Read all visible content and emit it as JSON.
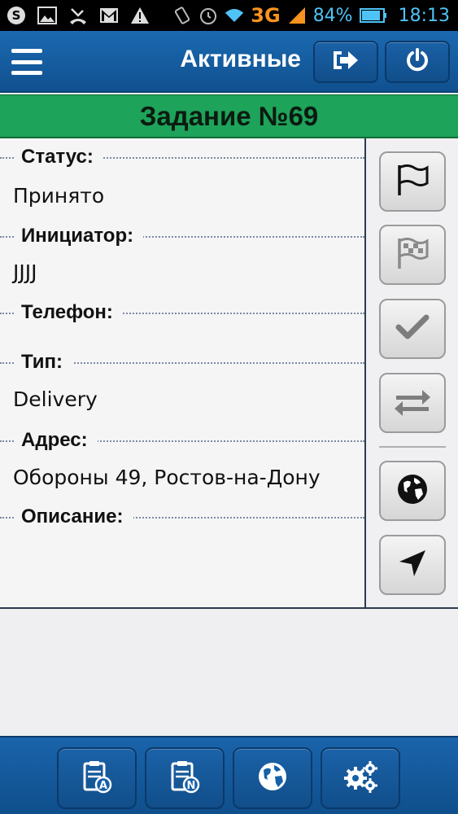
{
  "status_bar": {
    "network": "3G",
    "battery": "84%",
    "time": "18:13",
    "icons": [
      "skype-icon",
      "gallery-icon",
      "missed-call-icon",
      "gmail-icon",
      "warning-icon",
      "vibrate-icon",
      "alarm-icon",
      "wifi-icon",
      "signal-icon",
      "battery-icon"
    ]
  },
  "action_bar": {
    "title": "Активные",
    "menu_icon": "hamburger-menu-icon",
    "logout_icon": "logout-icon",
    "power_icon": "power-icon"
  },
  "task": {
    "title": "Задание №69"
  },
  "details": {
    "status_label": "Статус:",
    "status_value": "Принято",
    "initiator_label": "Инициатор:",
    "initiator_value": "JJJJ",
    "phone_label": "Телефон:",
    "phone_value": "",
    "type_label": "Тип:",
    "type_value": "Delivery",
    "address_label": "Адрес:",
    "address_value": "Обороны 49, Ростов-на-Дону",
    "description_label": "Описание:",
    "description_value": ""
  },
  "side_toolbar": {
    "buttons": [
      "start-flag-icon",
      "finish-flag-icon",
      "checkmark-icon",
      "transfer-arrows-icon",
      "globe-icon",
      "navigation-arrow-icon"
    ]
  },
  "bottom_bar": {
    "buttons": [
      "active-tasks-clipboard-icon",
      "new-tasks-clipboard-icon",
      "globe-icon",
      "settings-gears-icon"
    ]
  },
  "colors": {
    "accent_blue": "#1560a8",
    "header_green": "#1da35a",
    "status_time": "#4fc3f7",
    "network_orange": "#f7931e"
  }
}
